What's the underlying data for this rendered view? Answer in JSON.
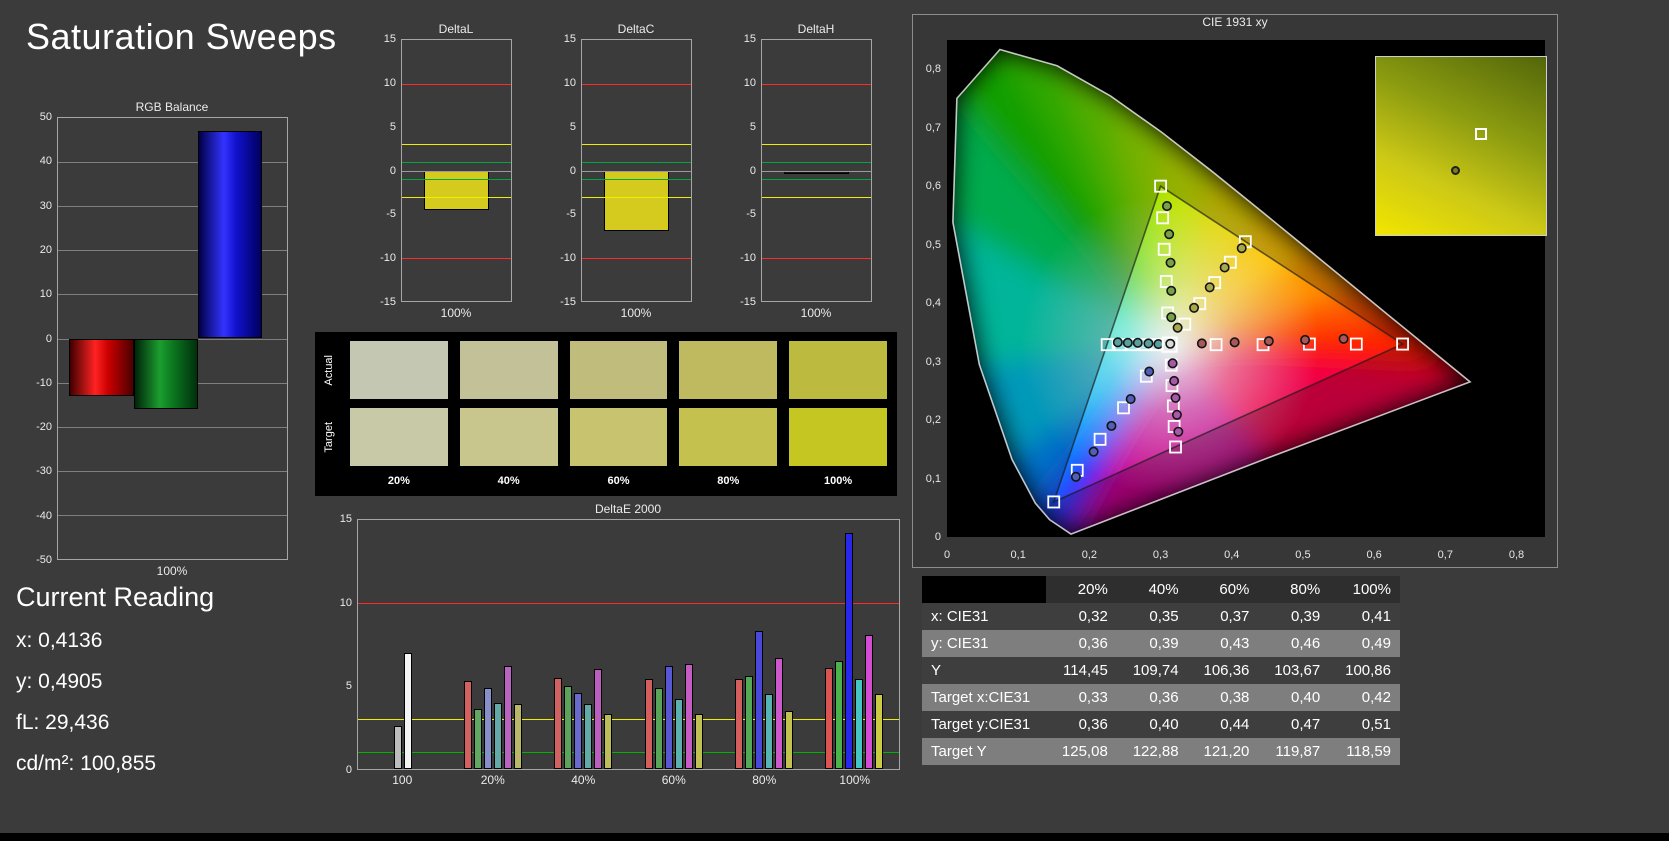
{
  "page": {
    "title": "Saturation Sweeps"
  },
  "current_reading": {
    "title": "Current Reading",
    "lines": [
      "x: 0,4136",
      "y: 0,4905",
      "fL: 29,436",
      "cd/m²: 100,855"
    ]
  },
  "swatches": {
    "row_labels": [
      "Actual",
      "Target"
    ],
    "col_labels": [
      "20%",
      "40%",
      "60%",
      "80%",
      "100%"
    ],
    "actual": [
      "#c4c7b1",
      "#c3c197",
      "#c0bc7c",
      "#bfba5f",
      "#bdba40"
    ],
    "target": [
      "#c8caa7",
      "#c8c68c",
      "#c7c36e",
      "#c5c14e",
      "#c6c623"
    ]
  },
  "table": {
    "headers": [
      "",
      "20%",
      "40%",
      "60%",
      "80%",
      "100%"
    ],
    "rows": [
      {
        "label": "x: CIE31",
        "values": [
          "0,32",
          "0,35",
          "0,37",
          "0,39",
          "0,41"
        ]
      },
      {
        "label": "y: CIE31",
        "values": [
          "0,36",
          "0,39",
          "0,43",
          "0,46",
          "0,49"
        ]
      },
      {
        "label": "Y",
        "values": [
          "114,45",
          "109,74",
          "106,36",
          "103,67",
          "100,86"
        ]
      },
      {
        "label": "Target x:CIE31",
        "values": [
          "0,33",
          "0,36",
          "0,38",
          "0,40",
          "0,42"
        ]
      },
      {
        "label": "Target y:CIE31",
        "values": [
          "0,36",
          "0,40",
          "0,44",
          "0,47",
          "0,51"
        ]
      },
      {
        "label": "Target Y",
        "values": [
          "125,08",
          "122,88",
          "121,20",
          "119,87",
          "118,59"
        ]
      }
    ]
  },
  "chart_data": {
    "rgb_balance": {
      "type": "bar",
      "title": "RGB Balance",
      "x_label": "100%",
      "ymin": -50,
      "ymax": 50,
      "ticks": [
        50,
        40,
        30,
        20,
        10,
        0,
        -10,
        -20,
        -30,
        -40,
        -50
      ],
      "bars": [
        {
          "name": "red",
          "value": -13
        },
        {
          "name": "green",
          "value": -16
        },
        {
          "name": "blue",
          "value": 47
        }
      ]
    },
    "delta_axis": {
      "ymin": -15,
      "ymax": 15,
      "ticks": [
        15,
        10,
        5,
        0,
        -5,
        -10,
        -15
      ],
      "ref_lines": [
        {
          "v": 10,
          "c": "#ff2a2a"
        },
        {
          "v": -10,
          "c": "#ff2a2a"
        },
        {
          "v": 3,
          "c": "#eeee00"
        },
        {
          "v": -3,
          "c": "#eeee00"
        },
        {
          "v": 1,
          "c": "#00a83c"
        },
        {
          "v": -1,
          "c": "#00a83c"
        },
        {
          "v": 0,
          "c": "#9b9b9b"
        }
      ]
    },
    "delta_charts": [
      {
        "type": "bar",
        "title": "DeltaL",
        "x_label": "100%",
        "value": -4.5,
        "bar_color": "#d5cb1e"
      },
      {
        "type": "bar",
        "title": "DeltaC",
        "x_label": "100%",
        "value": -7,
        "bar_color": "#d5cb1e"
      },
      {
        "type": "bar",
        "title": "DeltaH",
        "x_label": "100%",
        "value": -0.4,
        "bar_color": "#161616"
      }
    ],
    "deltae2000": {
      "type": "bar",
      "title": "DeltaE 2000",
      "ymin": 0,
      "ymax": 15,
      "ticks": [
        15,
        10,
        5,
        0
      ],
      "ref_lines": [
        {
          "v": 10,
          "c": "#ff2a2a"
        },
        {
          "v": 3,
          "c": "#eeee00"
        },
        {
          "v": 1,
          "c": "#00b400"
        }
      ],
      "groups": [
        {
          "label": "100",
          "bars": [
            {
              "c": "#bdbdbd",
              "v": 2.6
            },
            {
              "c": "#f4f4f4",
              "v": 7.0
            }
          ]
        },
        {
          "label": "20%",
          "bars": [
            {
              "c": "#d26262",
              "v": 5.3
            },
            {
              "c": "#62a862",
              "v": 3.6
            },
            {
              "c": "#8890cc",
              "v": 4.9
            },
            {
              "c": "#64a8a8",
              "v": 4.0
            },
            {
              "c": "#b864c0",
              "v": 6.2
            },
            {
              "c": "#b8b868",
              "v": 3.9
            }
          ]
        },
        {
          "label": "40%",
          "bars": [
            {
              "c": "#d26262",
              "v": 5.5
            },
            {
              "c": "#5ca45c",
              "v": 5.0
            },
            {
              "c": "#6a6ace",
              "v": 4.6
            },
            {
              "c": "#60aaaa",
              "v": 3.9
            },
            {
              "c": "#bc5ec0",
              "v": 6.0
            },
            {
              "c": "#bcbc5a",
              "v": 3.3
            }
          ]
        },
        {
          "label": "60%",
          "bars": [
            {
              "c": "#d25e5e",
              "v": 5.4
            },
            {
              "c": "#58a458",
              "v": 4.9
            },
            {
              "c": "#5858d4",
              "v": 6.2
            },
            {
              "c": "#5cb0b0",
              "v": 4.2
            },
            {
              "c": "#c45cc4",
              "v": 6.3
            },
            {
              "c": "#c0c054",
              "v": 3.3
            }
          ]
        },
        {
          "label": "80%",
          "bars": [
            {
              "c": "#d25e5e",
              "v": 5.4
            },
            {
              "c": "#54aa54",
              "v": 5.6
            },
            {
              "c": "#4848da",
              "v": 8.3
            },
            {
              "c": "#58b4b4",
              "v": 4.5
            },
            {
              "c": "#cc58cc",
              "v": 6.7
            },
            {
              "c": "#c2c250",
              "v": 3.5
            }
          ]
        },
        {
          "label": "100%",
          "bars": [
            {
              "c": "#da5454",
              "v": 6.1
            },
            {
              "c": "#4cb24c",
              "v": 6.5
            },
            {
              "c": "#2828ea",
              "v": 14.2
            },
            {
              "c": "#44c4c4",
              "v": 5.4
            },
            {
              "c": "#d44cd4",
              "v": 8.1
            },
            {
              "c": "#caca44",
              "v": 4.5
            }
          ]
        }
      ]
    },
    "cie": {
      "type": "scatter",
      "title": "CIE 1931 xy",
      "xticks": [
        "0",
        "0,1",
        "0,2",
        "0,3",
        "0,4",
        "0,5",
        "0,6",
        "0,7",
        "0,8"
      ],
      "yticks": [
        "0",
        "0,1",
        "0,2",
        "0,3",
        "0,4",
        "0,5",
        "0,6",
        "0,7",
        "0,8"
      ],
      "gamut_triangle": [
        [
          0.64,
          0.33
        ],
        [
          0.3,
          0.6
        ],
        [
          0.15,
          0.06
        ]
      ],
      "white_point": {
        "target": [
          0.3127,
          0.329
        ],
        "measured": [
          0.3136,
          0.3305
        ]
      },
      "sweeps": [
        {
          "name": "red",
          "dot": "#a85858",
          "targets": [
            [
              0.378,
              0.329
            ],
            [
              0.444,
              0.329
            ],
            [
              0.509,
              0.33
            ],
            [
              0.575,
              0.33
            ],
            [
              0.64,
              0.33
            ]
          ],
          "measured": [
            [
              0.358,
              0.331
            ],
            [
              0.404,
              0.333
            ],
            [
              0.452,
              0.335
            ],
            [
              0.503,
              0.337
            ],
            [
              0.557,
              0.339
            ]
          ]
        },
        {
          "name": "green",
          "dot": "#78a048",
          "targets": [
            [
              0.31,
              0.383
            ],
            [
              0.308,
              0.437
            ],
            [
              0.305,
              0.492
            ],
            [
              0.303,
              0.546
            ],
            [
              0.3,
              0.6
            ]
          ],
          "measured": [
            [
              0.315,
              0.376
            ],
            [
              0.315,
              0.421
            ],
            [
              0.314,
              0.469
            ],
            [
              0.312,
              0.518
            ],
            [
              0.309,
              0.566
            ]
          ]
        },
        {
          "name": "blue",
          "dot": "#5060b8",
          "targets": [
            [
              0.28,
              0.275
            ],
            [
              0.248,
              0.221
            ],
            [
              0.215,
              0.167
            ],
            [
              0.183,
              0.114
            ],
            [
              0.15,
              0.06
            ]
          ],
          "measured": [
            [
              0.284,
              0.283
            ],
            [
              0.258,
              0.236
            ],
            [
              0.231,
              0.19
            ],
            [
              0.206,
              0.146
            ],
            [
              0.181,
              0.103
            ]
          ]
        },
        {
          "name": "cyan",
          "dot": "#58a0a0",
          "targets": [
            [
              0.295,
              0.329
            ],
            [
              0.278,
              0.329
            ],
            [
              0.26,
              0.329
            ],
            [
              0.243,
              0.329
            ],
            [
              0.225,
              0.329
            ]
          ],
          "measured": [
            [
              0.297,
              0.33
            ],
            [
              0.283,
              0.331
            ],
            [
              0.268,
              0.332
            ],
            [
              0.254,
              0.332
            ],
            [
              0.24,
              0.333
            ]
          ]
        },
        {
          "name": "magenta",
          "dot": "#a858a8",
          "targets": [
            [
              0.315,
              0.294
            ],
            [
              0.316,
              0.259
            ],
            [
              0.318,
              0.224
            ],
            [
              0.319,
              0.189
            ],
            [
              0.321,
              0.154
            ]
          ],
          "measured": [
            [
              0.317,
              0.297
            ],
            [
              0.319,
              0.267
            ],
            [
              0.321,
              0.238
            ],
            [
              0.323,
              0.209
            ],
            [
              0.325,
              0.18
            ]
          ]
        },
        {
          "name": "yellow",
          "dot": "#a8a848",
          "targets": [
            [
              0.334,
              0.364
            ],
            [
              0.355,
              0.399
            ],
            [
              0.376,
              0.435
            ],
            [
              0.398,
              0.47
            ],
            [
              0.419,
              0.505
            ]
          ],
          "measured": [
            [
              0.324,
              0.358
            ],
            [
              0.347,
              0.392
            ],
            [
              0.369,
              0.427
            ],
            [
              0.39,
              0.461
            ],
            [
              0.414,
              0.494
            ]
          ]
        }
      ]
    }
  }
}
